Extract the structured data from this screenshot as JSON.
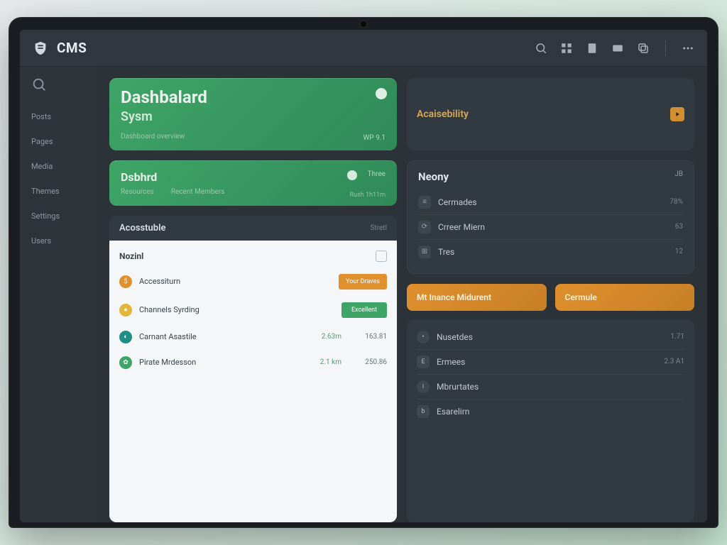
{
  "header": {
    "brand": "CMS",
    "icons": [
      "search-icon",
      "grid-icon",
      "doc-icon",
      "card-icon",
      "copy-icon",
      "more-icon"
    ]
  },
  "sidebar": {
    "items": [
      {
        "label": "Posts"
      },
      {
        "label": "Pages"
      },
      {
        "label": "Media"
      },
      {
        "label": "Themes"
      },
      {
        "label": "Settings"
      },
      {
        "label": "Users"
      }
    ]
  },
  "hero": {
    "title": "Dashbalard",
    "subtitle": "Sysm",
    "caption": "Dashboard overview",
    "stat": "WP 9.1"
  },
  "accessibility": {
    "label": "Acaisebility"
  },
  "dbcard": {
    "title": "Dsbhrd",
    "meta1": "Resources",
    "meta2": "Recent Members",
    "pill": "Three",
    "foot": "Rush 1h11m"
  },
  "neon": {
    "title": "Neony",
    "badge": "JB",
    "rows": [
      {
        "icon": "≡",
        "label": "Cermades",
        "val": "78%"
      },
      {
        "icon": "⟳",
        "label": "Crreer Miern",
        "val": "63"
      },
      {
        "icon": "⊞",
        "label": "Tres",
        "val": "12"
      }
    ]
  },
  "combo": {
    "header": "Acosstuble",
    "header_stat": "Stretl",
    "panel_title": "Nozinl",
    "rows": [
      {
        "color": "c-or",
        "label": "Accessiturn",
        "pill": "Your Draves",
        "pill_cls": "p-or",
        "v1": "",
        "v2": ""
      },
      {
        "color": "c-ye",
        "label": "Channels Syrding",
        "pill": "Excellent",
        "pill_cls": "p-gr",
        "v1": "",
        "v2": ""
      },
      {
        "color": "c-te",
        "label": "Carnant Asastile",
        "pill": "",
        "pill_cls": "",
        "v1": "2.63m",
        "v2": "163.81"
      },
      {
        "color": "c-gr",
        "label": "Pirate Mrdesson",
        "pill": "",
        "pill_cls": "",
        "v1": "2.1 km",
        "v2": "250.86"
      }
    ]
  },
  "orange": {
    "left": "Mt Inance Midurent",
    "right": "Cermule"
  },
  "list2": {
    "rows": [
      {
        "icon": "•",
        "shape": "rnd",
        "label": "Nusetdes",
        "val": "1.71"
      },
      {
        "icon": "E",
        "shape": "sq",
        "label": "Ermees",
        "val": "2.3 A1"
      },
      {
        "icon": "i",
        "shape": "rnd",
        "label": "Mbrurtates",
        "val": ""
      },
      {
        "icon": "b",
        "shape": "sq",
        "label": "Esarelirn",
        "val": ""
      }
    ]
  }
}
